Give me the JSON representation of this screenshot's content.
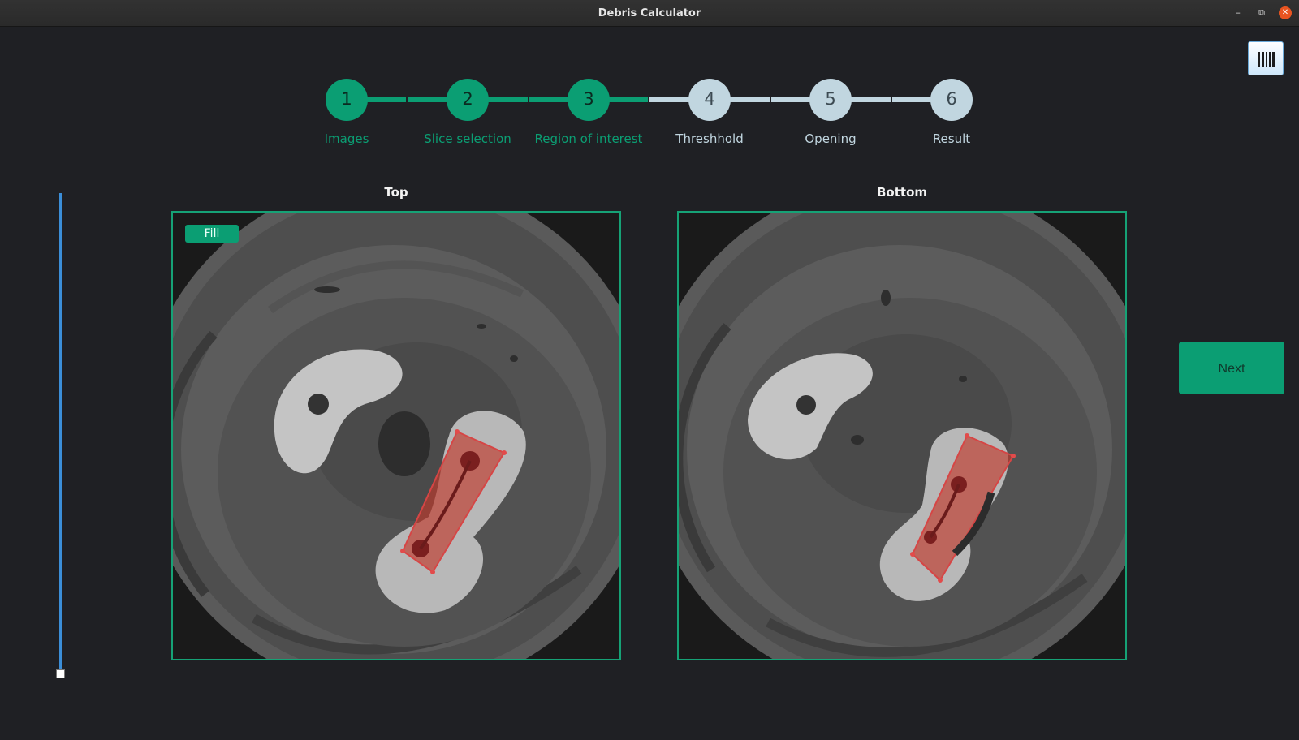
{
  "window": {
    "title": "Debris Calculator",
    "controls": {
      "minimize": "–",
      "maximize": "⧉",
      "close": "✕"
    }
  },
  "toolbar": {
    "menu_icon": "barcode-menu-icon"
  },
  "stepper": {
    "current_step": 3,
    "steps": [
      {
        "number": "1",
        "label": "Images",
        "state": "done"
      },
      {
        "number": "2",
        "label": "Slice selection",
        "state": "done"
      },
      {
        "number": "3",
        "label": "Region of interest",
        "state": "done"
      },
      {
        "number": "4",
        "label": "Threshhold",
        "state": "todo"
      },
      {
        "number": "5",
        "label": "Opening",
        "state": "todo"
      },
      {
        "number": "6",
        "label": "Result",
        "state": "todo"
      }
    ]
  },
  "slice_slider": {
    "level": 0.0
  },
  "panels": {
    "top": {
      "title": "Top",
      "fill_label": "Fill"
    },
    "bottom": {
      "title": "Bottom"
    }
  },
  "actions": {
    "next_label": "Next"
  },
  "colors": {
    "accent": "#0b9e73",
    "step_inactive": "#c1d6e0",
    "background": "#1f2024",
    "roi": "#d03a3a",
    "slider": "#3b8ed8"
  }
}
